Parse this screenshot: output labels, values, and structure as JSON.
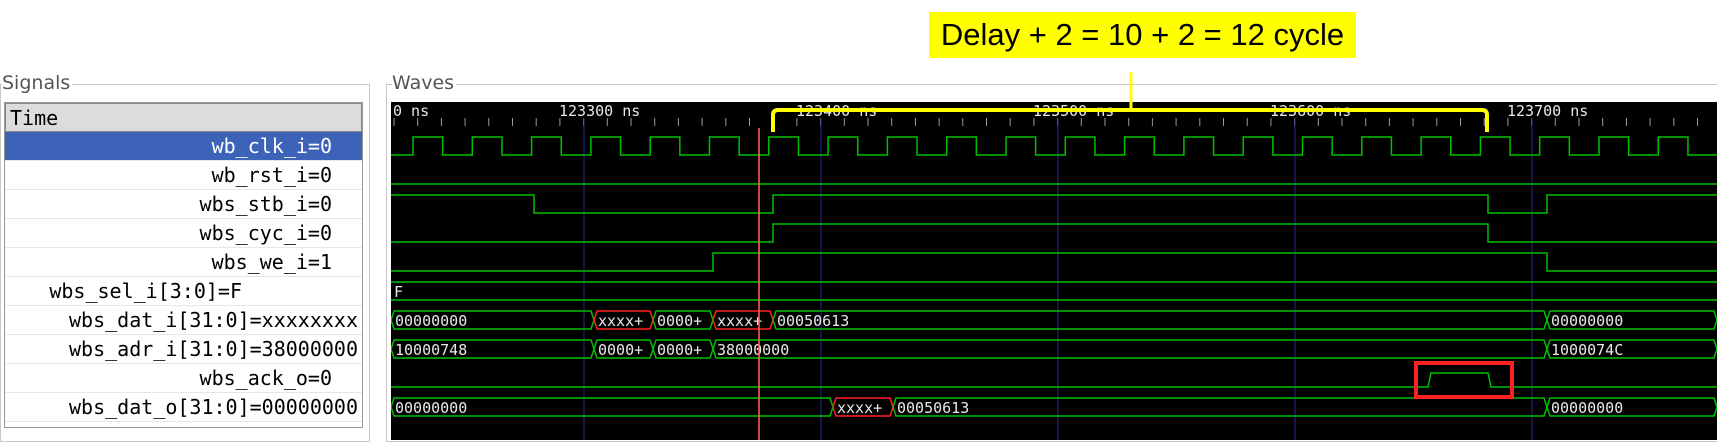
{
  "annotation": "Delay + 2 = 10 + 2 = 12 cycle",
  "panels": {
    "signals_title": "Signals",
    "waves_title": "Waves"
  },
  "signals": [
    {
      "label": "Time"
    },
    {
      "label": "wb_clk_i=0"
    },
    {
      "label": "wb_rst_i=0"
    },
    {
      "label": "wbs_stb_i=0"
    },
    {
      "label": "wbs_cyc_i=0"
    },
    {
      "label": "wbs_we_i=1"
    },
    {
      "label": "wbs_sel_i[3:0]=F"
    },
    {
      "label": "wbs_dat_i[31:0]=xxxxxxxx"
    },
    {
      "label": "wbs_adr_i[31:0]=38000000"
    },
    {
      "label": "wbs_ack_o=0"
    },
    {
      "label": "wbs_dat_o[31:0]=00000000"
    }
  ],
  "timeline": {
    "start_label": "0 ns",
    "ticks": [
      "123300 ns",
      "123400 ns",
      "123500 ns",
      "123600 ns",
      "123700 ns"
    ]
  },
  "buses": {
    "sel": [
      "F"
    ],
    "dat_i": [
      "00000000",
      "xxxx+",
      "0000+",
      "xxxx+",
      "00050613",
      "00000000"
    ],
    "adr_i": [
      "10000748",
      "0000+",
      "0000+",
      "38000000",
      "1000074C"
    ],
    "dat_o": [
      "00000000",
      "xxxx+",
      "00050613",
      "00000000"
    ]
  },
  "colors": {
    "wave": "#00c000",
    "marker": "#ff6a4d",
    "highlight": "#ff2020",
    "annotation": "#ffff00",
    "selected_row": "#3d63b8"
  }
}
